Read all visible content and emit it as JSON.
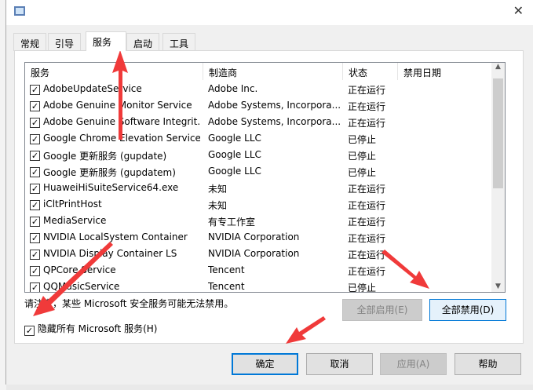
{
  "tabs": [
    "常规",
    "引导",
    "服务",
    "启动",
    "工具"
  ],
  "columns": [
    "服务",
    "制造商",
    "状态",
    "禁用日期"
  ],
  "rows": [
    [
      "AdobeUpdateService",
      "Adobe Inc.",
      "正在运行"
    ],
    [
      "Adobe Genuine Monitor Service",
      "Adobe Systems, Incorpora...",
      "正在运行"
    ],
    [
      "Adobe Genuine Software Integrit...",
      "Adobe Systems, Incorpora...",
      "正在运行"
    ],
    [
      "Google Chrome Elevation Service",
      "Google LLC",
      "已停止"
    ],
    [
      "Google 更新服务 (gupdate)",
      "Google LLC",
      "已停止"
    ],
    [
      "Google 更新服务 (gupdatem)",
      "Google LLC",
      "已停止"
    ],
    [
      "HuaweiHiSuiteService64.exe",
      "未知",
      "正在运行"
    ],
    [
      "iCltPrintHost",
      "未知",
      "正在运行"
    ],
    [
      "MediaService",
      "有专工作室",
      "正在运行"
    ],
    [
      "NVIDIA LocalSystem Container",
      "NVIDIA Corporation",
      "正在运行"
    ],
    [
      "NVIDIA Display Container LS",
      "NVIDIA Corporation",
      "正在运行"
    ],
    [
      "QPCore Service",
      "Tencent",
      "正在运行"
    ],
    [
      "QQMusicService",
      "Tencent",
      "已停止"
    ]
  ],
  "note": "请注意，某些 Microsoft 安全服务可能无法禁用。",
  "enable_all": "全部启用(E)",
  "disable_all": "全部禁用(D)",
  "hide_ms": "隐藏所有 Microsoft 服务(H)",
  "ok": "确定",
  "cancel": "取消",
  "apply": "应用(A)",
  "help": "帮助",
  "close": "✕",
  "check": "✓"
}
